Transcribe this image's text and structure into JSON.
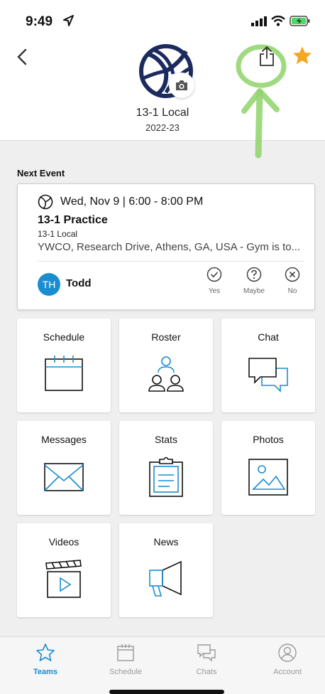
{
  "status_bar": {
    "time": "9:49"
  },
  "header": {
    "team_name": "13-1 Local",
    "season": "2022-23"
  },
  "next_event": {
    "section_label": "Next Event",
    "date_time": "Wed, Nov 9 | 6:00 - 8:00 PM",
    "title": "13-1 Practice",
    "team": "13-1 Local",
    "location": "YWCO, Research Drive, Athens, GA, USA - Gym is to...",
    "member_initials": "TH",
    "member_name": "Todd",
    "rsvp": {
      "yes": "Yes",
      "maybe": "Maybe",
      "no": "No"
    }
  },
  "tiles": {
    "schedule": "Schedule",
    "roster": "Roster",
    "chat": "Chat",
    "messages": "Messages",
    "stats": "Stats",
    "photos": "Photos",
    "videos": "Videos",
    "news": "News"
  },
  "tabbar": {
    "teams": "Teams",
    "schedule": "Schedule",
    "chats": "Chats",
    "account": "Account"
  },
  "colors": {
    "accent": "#1a8dd0",
    "navy": "#1b2b5e",
    "star": "#f5a623",
    "highlight": "#8fd46a"
  },
  "icons": [
    "location-arrow-icon",
    "signal-icon",
    "wifi-icon",
    "battery-icon",
    "back-chevron-icon",
    "volleyball-icon",
    "camera-icon",
    "share-icon",
    "star-icon",
    "check-circle-icon",
    "question-circle-icon",
    "x-circle-icon",
    "calendar-icon",
    "people-icon",
    "chat-bubbles-icon",
    "envelope-icon",
    "clipboard-icon",
    "picture-icon",
    "clapperboard-icon",
    "megaphone-icon",
    "account-icon"
  ]
}
